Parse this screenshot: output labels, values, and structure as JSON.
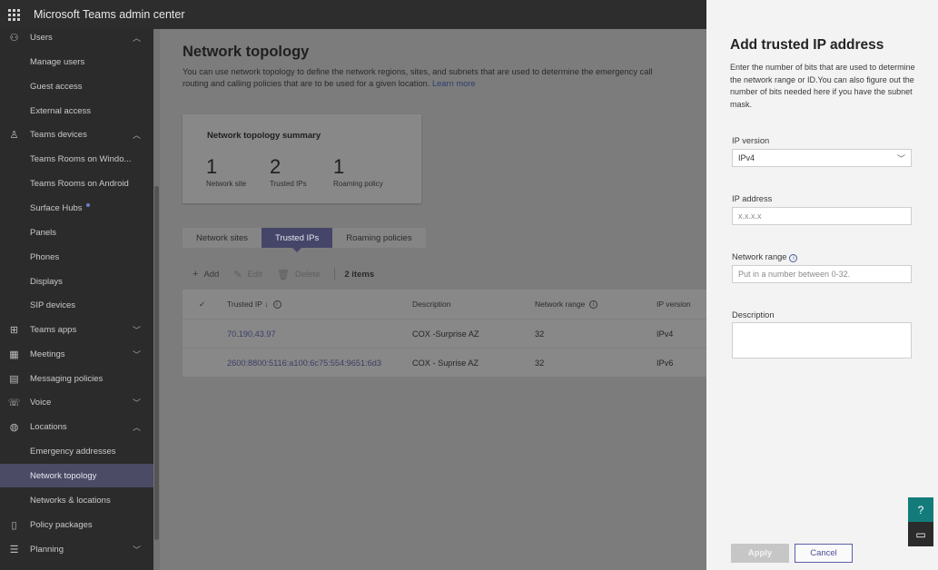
{
  "app": {
    "title": "Microsoft Teams admin center"
  },
  "sidebar": {
    "items": [
      {
        "label": "Users",
        "icon": "users-icon",
        "chevron": "up"
      },
      {
        "label": "Manage users",
        "sub": true
      },
      {
        "label": "Guest access",
        "sub": true
      },
      {
        "label": "External access",
        "sub": true
      },
      {
        "label": "Teams devices",
        "icon": "devices-icon",
        "chevron": "up"
      },
      {
        "label": "Teams Rooms on Windo...",
        "sub": true
      },
      {
        "label": "Teams Rooms on Android",
        "sub": true
      },
      {
        "label": "Surface Hubs",
        "sub": true,
        "dot": true
      },
      {
        "label": "Panels",
        "sub": true
      },
      {
        "label": "Phones",
        "sub": true
      },
      {
        "label": "Displays",
        "sub": true
      },
      {
        "label": "SIP devices",
        "sub": true
      },
      {
        "label": "Teams apps",
        "icon": "apps-icon",
        "chevron": "down"
      },
      {
        "label": "Meetings",
        "icon": "calendar-icon",
        "chevron": "down"
      },
      {
        "label": "Messaging policies",
        "icon": "message-icon"
      },
      {
        "label": "Voice",
        "icon": "voice-icon",
        "chevron": "down"
      },
      {
        "label": "Locations",
        "icon": "globe-icon",
        "chevron": "up"
      },
      {
        "label": "Emergency addresses",
        "sub": true
      },
      {
        "label": "Network topology",
        "sub": true,
        "active": true
      },
      {
        "label": "Networks & locations",
        "sub": true
      },
      {
        "label": "Policy packages",
        "icon": "package-icon"
      },
      {
        "label": "Planning",
        "icon": "planning-icon",
        "chevron": "down"
      }
    ]
  },
  "page": {
    "title": "Network topology",
    "description": "You can use network topology to define the network regions, sites, and subnets that are used to determine the emergency call routing and calling policies that are to be used for a given location.",
    "learn_more": "Learn more"
  },
  "summary": {
    "title": "Network topology summary",
    "stats": [
      {
        "value": "1",
        "caption": "Network site"
      },
      {
        "value": "2",
        "caption": "Trusted IPs"
      },
      {
        "value": "1",
        "caption": "Roaming policy"
      }
    ]
  },
  "tabs": [
    {
      "label": "Network sites"
    },
    {
      "label": "Trusted IPs",
      "active": true
    },
    {
      "label": "Roaming policies"
    }
  ],
  "toolbar": {
    "add": "Add",
    "edit": "Edit",
    "delete": "Delete",
    "count": "2 items"
  },
  "table": {
    "columns": {
      "trusted_ip": "Trusted IP",
      "description": "Description",
      "network_range": "Network range",
      "ip_version": "IP version"
    },
    "rows": [
      {
        "trusted_ip": "70.190.43.97",
        "description": "COX -Surprise AZ",
        "network_range": "32",
        "ip_version": "IPv4"
      },
      {
        "trusted_ip": "2600:8800:5116:a100:6c75:554:9651:6d3",
        "description": "COX - Suprise AZ",
        "network_range": "32",
        "ip_version": "IPv6"
      }
    ]
  },
  "panel": {
    "title": "Add trusted IP address",
    "description": "Enter the number of bits that are used to determine the network range or ID.You can also figure out the number of bits needed here if you have the subnet mask.",
    "ip_version": {
      "label": "IP version",
      "value": "IPv4"
    },
    "ip_address": {
      "label": "IP address",
      "placeholder": "x.x.x.x"
    },
    "network_range": {
      "label": "Network range",
      "placeholder": "Put in a number between 0-32."
    },
    "description_field": {
      "label": "Description",
      "value": ""
    },
    "apply": "Apply",
    "cancel": "Cancel"
  },
  "colors": {
    "topbar": "#2d2d2d",
    "sidebar": "#2b2b2b",
    "active_nav": "#4b4b66",
    "active_tab": "#454569",
    "help_fab": "#137c7a",
    "cancel_border": "#5b5fa8"
  }
}
